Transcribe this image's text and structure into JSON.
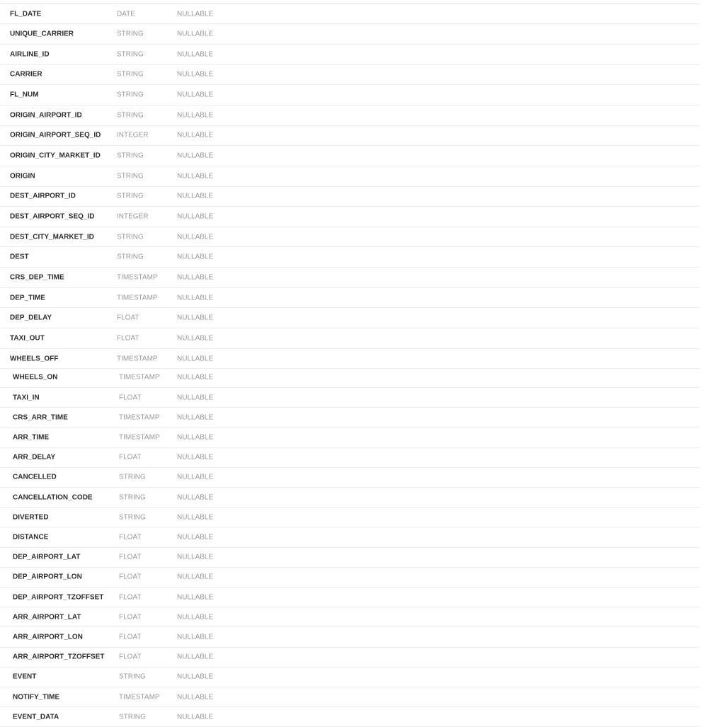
{
  "schema": {
    "fields": [
      {
        "name": "FL_DATE",
        "type": "DATE",
        "mode": "NULLABLE"
      },
      {
        "name": "UNIQUE_CARRIER",
        "type": "STRING",
        "mode": "NULLABLE"
      },
      {
        "name": "AIRLINE_ID",
        "type": "STRING",
        "mode": "NULLABLE"
      },
      {
        "name": "CARRIER",
        "type": "STRING",
        "mode": "NULLABLE"
      },
      {
        "name": "FL_NUM",
        "type": "STRING",
        "mode": "NULLABLE"
      },
      {
        "name": "ORIGIN_AIRPORT_ID",
        "type": "STRING",
        "mode": "NULLABLE"
      },
      {
        "name": "ORIGIN_AIRPORT_SEQ_ID",
        "type": "INTEGER",
        "mode": "NULLABLE"
      },
      {
        "name": "ORIGIN_CITY_MARKET_ID",
        "type": "STRING",
        "mode": "NULLABLE"
      },
      {
        "name": "ORIGIN",
        "type": "STRING",
        "mode": "NULLABLE"
      },
      {
        "name": "DEST_AIRPORT_ID",
        "type": "STRING",
        "mode": "NULLABLE"
      },
      {
        "name": "DEST_AIRPORT_SEQ_ID",
        "type": "INTEGER",
        "mode": "NULLABLE"
      },
      {
        "name": "DEST_CITY_MARKET_ID",
        "type": "STRING",
        "mode": "NULLABLE"
      },
      {
        "name": "DEST",
        "type": "STRING",
        "mode": "NULLABLE"
      },
      {
        "name": "CRS_DEP_TIME",
        "type": "TIMESTAMP",
        "mode": "NULLABLE"
      },
      {
        "name": "DEP_TIME",
        "type": "TIMESTAMP",
        "mode": "NULLABLE"
      },
      {
        "name": "DEP_DELAY",
        "type": "FLOAT",
        "mode": "NULLABLE"
      },
      {
        "name": "TAXI_OUT",
        "type": "FLOAT",
        "mode": "NULLABLE"
      },
      {
        "name": "WHEELS_OFF",
        "type": "TIMESTAMP",
        "mode": "NULLABLE"
      },
      {
        "name": "WHEELS_ON",
        "type": "TIMESTAMP",
        "mode": "NULLABLE"
      },
      {
        "name": "TAXI_IN",
        "type": "FLOAT",
        "mode": "NULLABLE"
      },
      {
        "name": "CRS_ARR_TIME",
        "type": "TIMESTAMP",
        "mode": "NULLABLE"
      },
      {
        "name": "ARR_TIME",
        "type": "TIMESTAMP",
        "mode": "NULLABLE"
      },
      {
        "name": "ARR_DELAY",
        "type": "FLOAT",
        "mode": "NULLABLE"
      },
      {
        "name": "CANCELLED",
        "type": "STRING",
        "mode": "NULLABLE"
      },
      {
        "name": "CANCELLATION_CODE",
        "type": "STRING",
        "mode": "NULLABLE"
      },
      {
        "name": "DIVERTED",
        "type": "STRING",
        "mode": "NULLABLE"
      },
      {
        "name": "DISTANCE",
        "type": "FLOAT",
        "mode": "NULLABLE"
      },
      {
        "name": "DEP_AIRPORT_LAT",
        "type": "FLOAT",
        "mode": "NULLABLE"
      },
      {
        "name": "DEP_AIRPORT_LON",
        "type": "FLOAT",
        "mode": "NULLABLE"
      },
      {
        "name": "DEP_AIRPORT_TZOFFSET",
        "type": "FLOAT",
        "mode": "NULLABLE"
      },
      {
        "name": "ARR_AIRPORT_LAT",
        "type": "FLOAT",
        "mode": "NULLABLE"
      },
      {
        "name": "ARR_AIRPORT_LON",
        "type": "FLOAT",
        "mode": "NULLABLE"
      },
      {
        "name": "ARR_AIRPORT_TZOFFSET",
        "type": "FLOAT",
        "mode": "NULLABLE"
      },
      {
        "name": "EVENT",
        "type": "STRING",
        "mode": "NULLABLE"
      },
      {
        "name": "NOTIFY_TIME",
        "type": "TIMESTAMP",
        "mode": "NULLABLE"
      },
      {
        "name": "EVENT_DATA",
        "type": "STRING",
        "mode": "NULLABLE"
      }
    ]
  }
}
